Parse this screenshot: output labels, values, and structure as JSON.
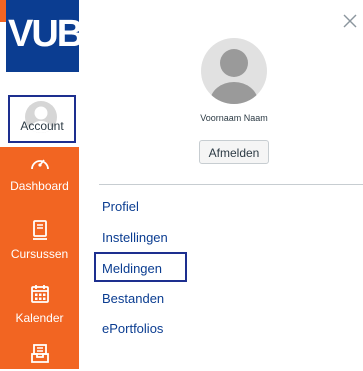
{
  "sidebar": {
    "logo_text": "VUB",
    "account_label": "Account",
    "items": [
      {
        "label": "Dashboard",
        "icon": "dashboard-icon"
      },
      {
        "label": "Cursussen",
        "icon": "courses-icon"
      },
      {
        "label": "Kalender",
        "icon": "calendar-icon"
      },
      {
        "label": "",
        "icon": "inbox-icon"
      }
    ]
  },
  "tray": {
    "user_name": "Voornaam Naam",
    "logout_label": "Afmelden",
    "links": [
      "Profiel",
      "Instellingen",
      "Meldingen",
      "Bestanden",
      "ePortfolios"
    ],
    "highlighted_link": "Meldingen"
  },
  "colors": {
    "brand_blue": "#0b3d91",
    "brand_orange": "#f26522",
    "highlight_border": "#1d2f8f"
  }
}
